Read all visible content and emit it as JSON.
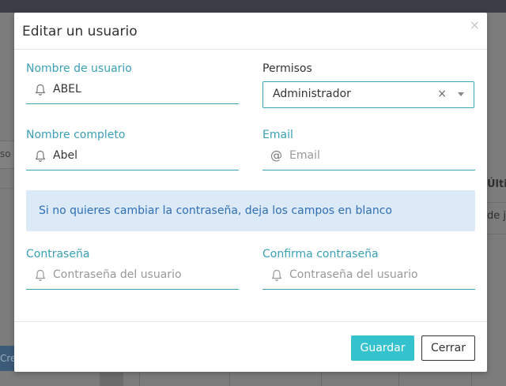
{
  "background": {
    "partial_input_text": "so",
    "right_header_partial": "Últin",
    "right_row_partial": "de j",
    "create_button_partial": "Cre"
  },
  "modal": {
    "title": "Editar un usuario",
    "close_glyph": "×",
    "fields": {
      "username": {
        "label": "Nombre de usuario",
        "value": "ABEL",
        "icon": "bell-icon"
      },
      "permissions": {
        "label": "Permisos",
        "selected": "Administrador",
        "clear_glyph": "×"
      },
      "fullname": {
        "label": "Nombre completo",
        "value": "Abel",
        "icon": "bell-icon"
      },
      "email": {
        "label": "Email",
        "placeholder": "Email",
        "icon": "at-icon",
        "icon_glyph": "@"
      },
      "password": {
        "label": "Contraseña",
        "placeholder": "Contraseña del usuario",
        "icon": "bell-icon"
      },
      "confirm_password": {
        "label": "Confirma contraseña",
        "placeholder": "Contraseña del usuario",
        "icon": "bell-icon"
      }
    },
    "info_message": "Si no quieres cambiar la contraseña, deja los campos en blanco",
    "buttons": {
      "save": "Guardar",
      "cancel": "Cerrar"
    }
  },
  "colors": {
    "accent": "#3aa0b5",
    "primary_button": "#34c2cf",
    "info_bg": "#dce9f7",
    "info_text": "#2f6fb6"
  }
}
